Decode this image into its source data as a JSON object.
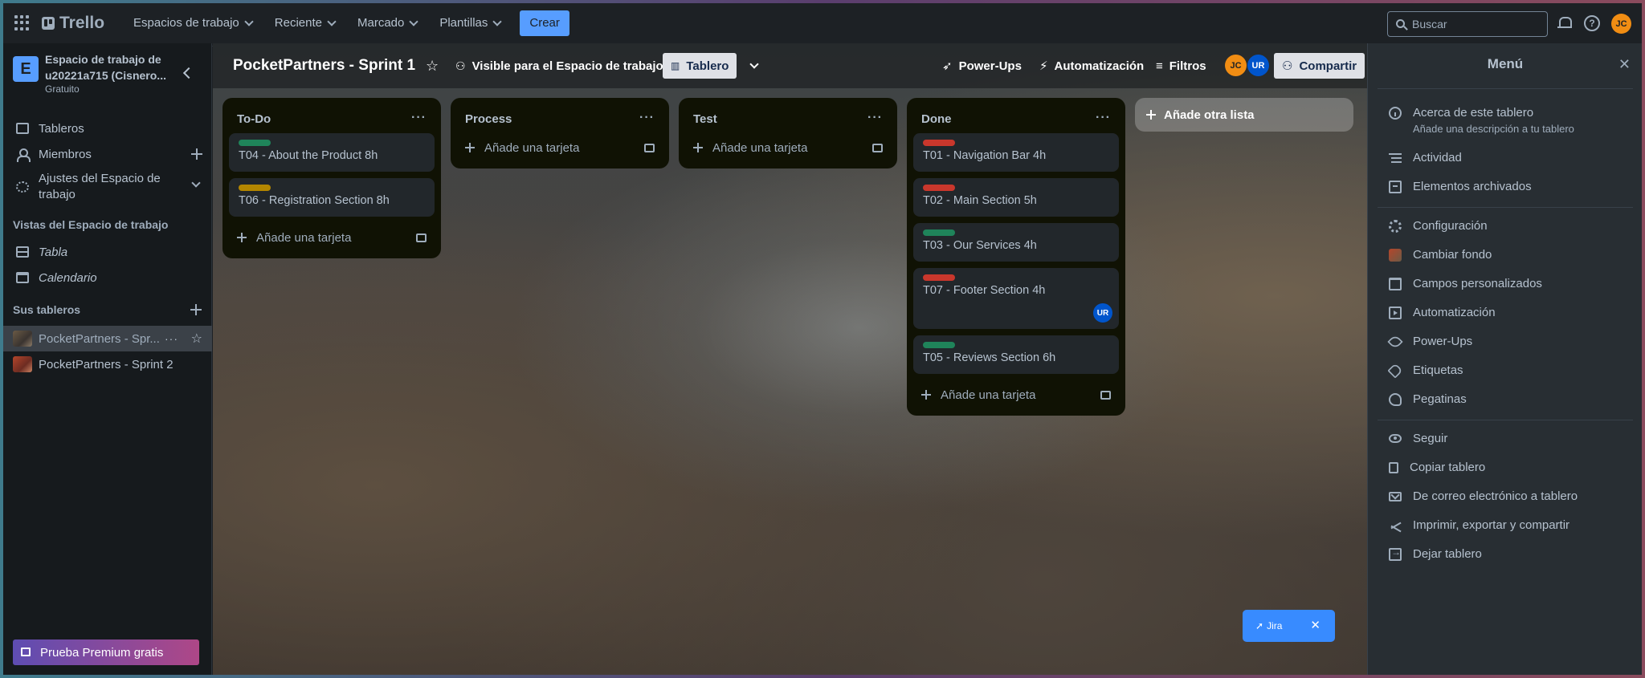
{
  "topbar": {
    "logo": "Trello",
    "nav": [
      "Espacios de trabajo",
      "Reciente",
      "Marcado",
      "Plantillas"
    ],
    "create_label": "Crear",
    "search_placeholder": "Buscar",
    "avatar": "JC"
  },
  "sidebar": {
    "workspace_badge": "E",
    "workspace_name": "Espacio de trabajo de u20221a715 (Cisnero...",
    "workspace_plan": "Gratuito",
    "items": [
      "Tableros",
      "Miembros",
      "Ajustes del Espacio de trabajo"
    ],
    "views_heading": "Vistas del Espacio de trabajo",
    "views": [
      "Tabla",
      "Calendario"
    ],
    "boards_heading": "Sus tableros",
    "boards": [
      "PocketPartners - Spr...",
      "PocketPartners - Sprint 2"
    ],
    "premium_label": "Prueba Premium gratis"
  },
  "board": {
    "title": "PocketPartners - Sprint 1",
    "visibility": "Visible para el Espacio de trabajo",
    "view": "Tablero",
    "powerups": "Power-Ups",
    "automation": "Automatización",
    "filters": "Filtros",
    "members": [
      "JC",
      "UR"
    ],
    "share": "Compartir",
    "add_card_label": "Añade una tarjeta",
    "add_list_label": "Añade otra lista",
    "jira_label": "Jira",
    "lists": [
      {
        "title": "To-Do",
        "cards": [
          {
            "title": "T04 - About the Product 8h",
            "label_color": "#1f845a"
          },
          {
            "title": "T06 - Registration Section 8h",
            "label_color": "#b38600"
          }
        ]
      },
      {
        "title": "Process",
        "cards": []
      },
      {
        "title": "Test",
        "cards": []
      },
      {
        "title": "Done",
        "cards": [
          {
            "title": "T01 - Navigation Bar 4h",
            "label_color": "#c9372c"
          },
          {
            "title": "T02 - Main Section 5h",
            "label_color": "#c9372c"
          },
          {
            "title": "T03 - Our Services 4h",
            "label_color": "#1f845a"
          },
          {
            "title": "T07 - Footer Section 4h",
            "label_color": "#c9372c",
            "member": "UR"
          },
          {
            "title": "T05 - Reviews Section 6h",
            "label_color": "#1f845a"
          }
        ]
      }
    ]
  },
  "menu": {
    "title": "Menú",
    "about_title": "Acerca de este tablero",
    "about_sub": "Añade una descripción a tu tablero",
    "items_a": [
      "Actividad",
      "Elementos archivados"
    ],
    "items_b": [
      "Configuración",
      "Cambiar fondo",
      "Campos personalizados",
      "Automatización",
      "Power-Ups",
      "Etiquetas",
      "Pegatinas"
    ],
    "items_c": [
      "Seguir",
      "Copiar tablero",
      "De correo electrónico a tablero",
      "Imprimir, exportar y compartir",
      "Dejar tablero"
    ]
  }
}
